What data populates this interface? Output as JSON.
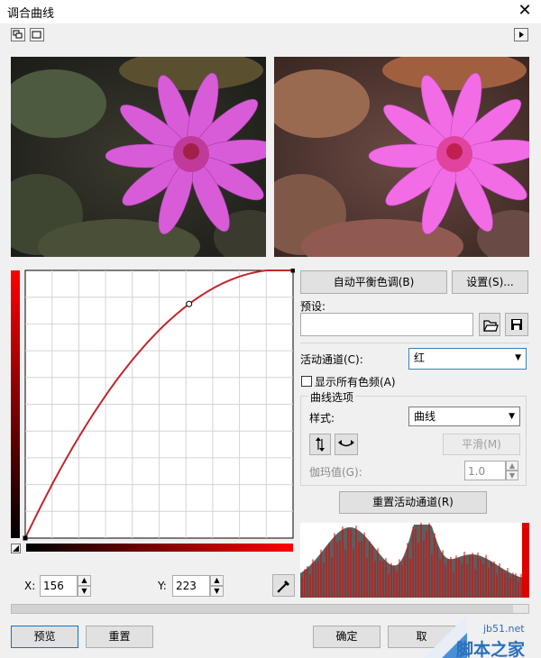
{
  "window": {
    "title": "调合曲线",
    "close_glyph": "✕"
  },
  "toolbar": {
    "layout_icon_1": "split-view-icon",
    "layout_icon_2": "single-view-icon",
    "expand_icon": "triangle-right-icon"
  },
  "buttons": {
    "auto_balance": "自动平衡色调(B)",
    "settings": "设置(S)...",
    "reset_channel": "重置活动通道(R)",
    "smooth": "平滑(M)",
    "preview": "预览",
    "reset": "重置",
    "ok": "确定",
    "cancel": "取"
  },
  "presets": {
    "label": "预设:",
    "value": ""
  },
  "channel": {
    "label": "活动通道(C):",
    "value": "红"
  },
  "show_all": {
    "label": "显示所有色频(A)",
    "checked": false
  },
  "curve_options": {
    "group_label": "曲线选项",
    "style_label": "样式:",
    "style_value": "曲线",
    "gamma_label": "伽玛值(G):",
    "gamma_value": "1.0"
  },
  "coords": {
    "x_label": "X:",
    "x_value": "156",
    "y_label": "Y:",
    "y_value": "223"
  },
  "curve": {
    "color": "#c0262e",
    "control_points": [
      [
        0,
        0
      ],
      [
        156,
        223
      ],
      [
        255,
        255
      ]
    ]
  },
  "colors": {
    "accent_red": "#e00000",
    "histogram_gray": "#5e5e5e"
  },
  "watermark": {
    "site": "jb51.net",
    "name": "脚本之家"
  }
}
